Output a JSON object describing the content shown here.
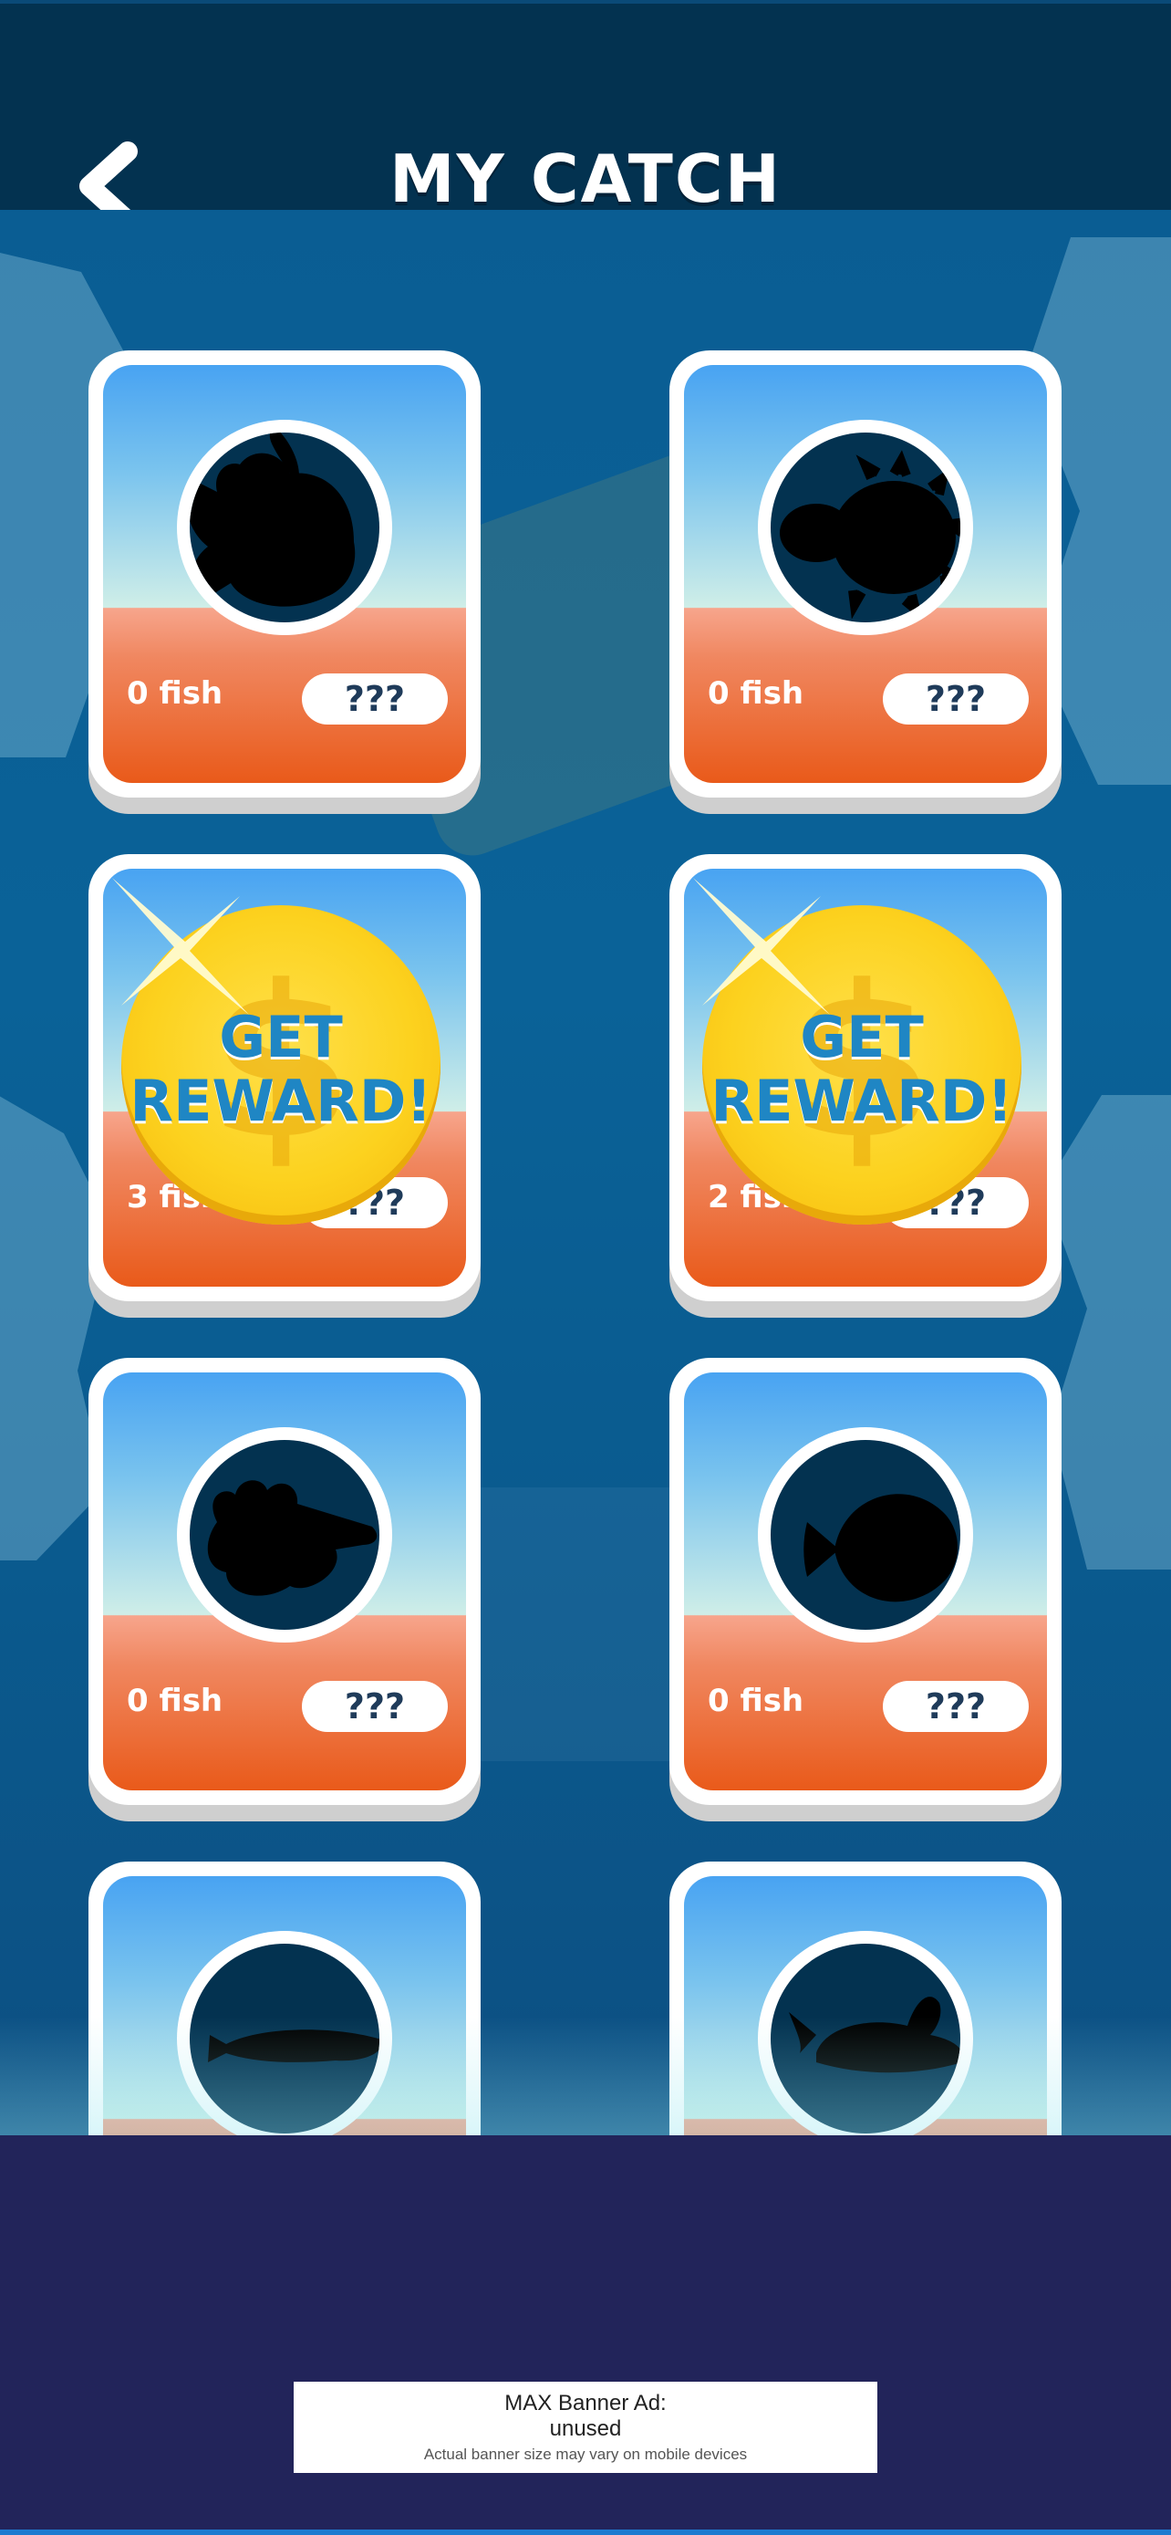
{
  "header": {
    "title": "MY CATCH"
  },
  "cards": [
    {
      "count": "0 fish",
      "name": "???",
      "fish": "goldfish-silhouette",
      "reward": false
    },
    {
      "count": "0 fish",
      "name": "???",
      "fish": "pufferfish-silhouette",
      "reward": false
    },
    {
      "count": "3 fish",
      "name": "???",
      "fish": "hidden",
      "reward": true
    },
    {
      "count": "2 fish",
      "name": "???",
      "fish": "hidden",
      "reward": true
    },
    {
      "count": "0 fish",
      "name": "???",
      "fish": "lionfish-silhouette",
      "reward": false
    },
    {
      "count": "0 fish",
      "name": "???",
      "fish": "flounder-silhouette",
      "reward": false
    },
    {
      "count": "",
      "name": "",
      "fish": "eel-silhouette",
      "reward": false
    },
    {
      "count": "",
      "name": "",
      "fish": "sailfish-silhouette",
      "reward": false
    }
  ],
  "reward_label_line1": "GET",
  "reward_label_line2": "REWARD!",
  "ad": {
    "line1": "MAX Banner Ad:",
    "line2": "unused",
    "line3": "Actual banner size may vary on mobile devices"
  },
  "colors": {
    "header": "#033250",
    "accent": "#1f86c4",
    "coin": "#fcd21f"
  }
}
